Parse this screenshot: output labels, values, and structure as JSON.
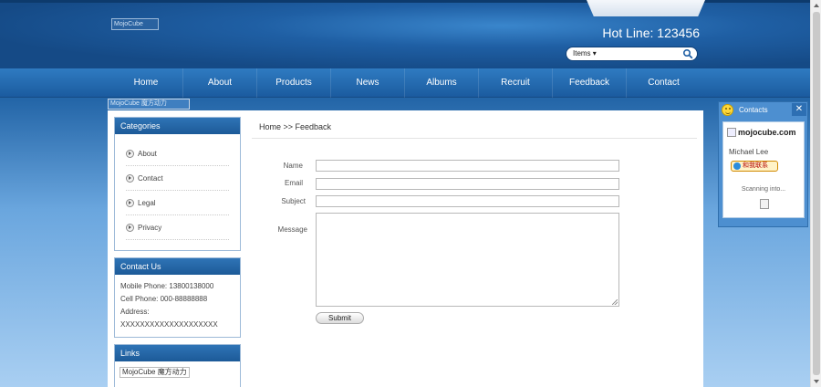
{
  "header": {
    "logo_alt": "MojoCube",
    "hotline": "Hot Line: 123456",
    "search": {
      "select_label": "Items"
    }
  },
  "nav": {
    "items": [
      "Home",
      "About",
      "Products",
      "News",
      "Albums",
      "Recruit",
      "Feedback",
      "Contact"
    ]
  },
  "banner_alt": "MojoCube 魔方动力",
  "sidebar": {
    "categories": {
      "title": "Categories",
      "items": [
        "About",
        "Contact",
        "Legal",
        "Privacy"
      ]
    },
    "contact_us": {
      "title": "Contact Us",
      "mobile": "Mobile Phone: 13800138000",
      "cell": "Cell Phone: 000-88888888",
      "address_label": "Address:",
      "address_value": "XXXXXXXXXXXXXXXXXXXX"
    },
    "links": {
      "title": "Links",
      "item": "MojoCube 魔方动力"
    }
  },
  "content": {
    "breadcrumb": "Home >> Feedback",
    "form": {
      "name_label": "Name",
      "email_label": "Email",
      "subject_label": "Subject",
      "message_label": "Message",
      "submit_label": "Submit"
    }
  },
  "widget": {
    "title": "Contacts",
    "close": "✕",
    "logo_text": "mojocube.com",
    "person": "Michael Lee",
    "badge": "和我联系",
    "scanning": "Scanning into..."
  }
}
